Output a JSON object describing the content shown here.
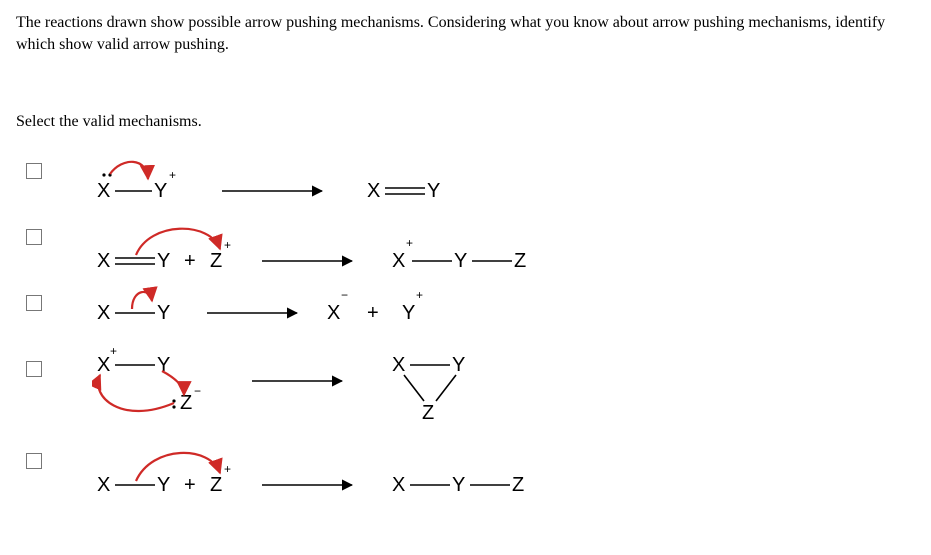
{
  "intro": "The reactions drawn show possible arrow pushing mechanisms. Considering what you know about arrow pushing mechanisms, identify which show valid arrow pushing.",
  "prompt": "Select the valid mechanisms.",
  "options": {
    "opt1": {
      "id": "opt1",
      "description": "Lone pair on X pushes to X–Y bond (Y is positive) → X=Y",
      "reactant": "X—Y(+) with lone pair on X, curved arrow from lone pair to X–Y bond",
      "product": "X=Y"
    },
    "opt2": {
      "id": "opt2",
      "description": "Curved arrow from X=Y π-bond to Z(+) → X(+)—Y—Z",
      "reactant": "X=Y + Z(+), curved arrow from π bond to Z",
      "product": "X(+)—Y—Z"
    },
    "opt3": {
      "id": "opt3",
      "description": "Curved arrow from X–Y bond to X → X(−) + Y(+)",
      "reactant": "X—Y, curved arrow from bond to X",
      "product": "X(−) + Y(+)"
    },
    "opt4": {
      "id": "opt4",
      "description": "X(+)—Y with Z(−) lone pair; arrow from Z lone pair to X, arrow from X–Y bond to Y; forms X—Y with both on Z (three-membered ring)",
      "reactant": "X(+)—Y and :Z(−); curved arrow from :Z to X, curved arrow from X–Y bond loops back",
      "product": "three-membered ring X—Y, both bonded to Z"
    },
    "opt5": {
      "id": "opt5",
      "description": "Curved arrow from X–Y bond to Z(+) → X—Y—Z",
      "reactant": "X—Y + Z(+), curved arrow from X–Y bond to Z",
      "product": "X—Y—Z"
    }
  }
}
